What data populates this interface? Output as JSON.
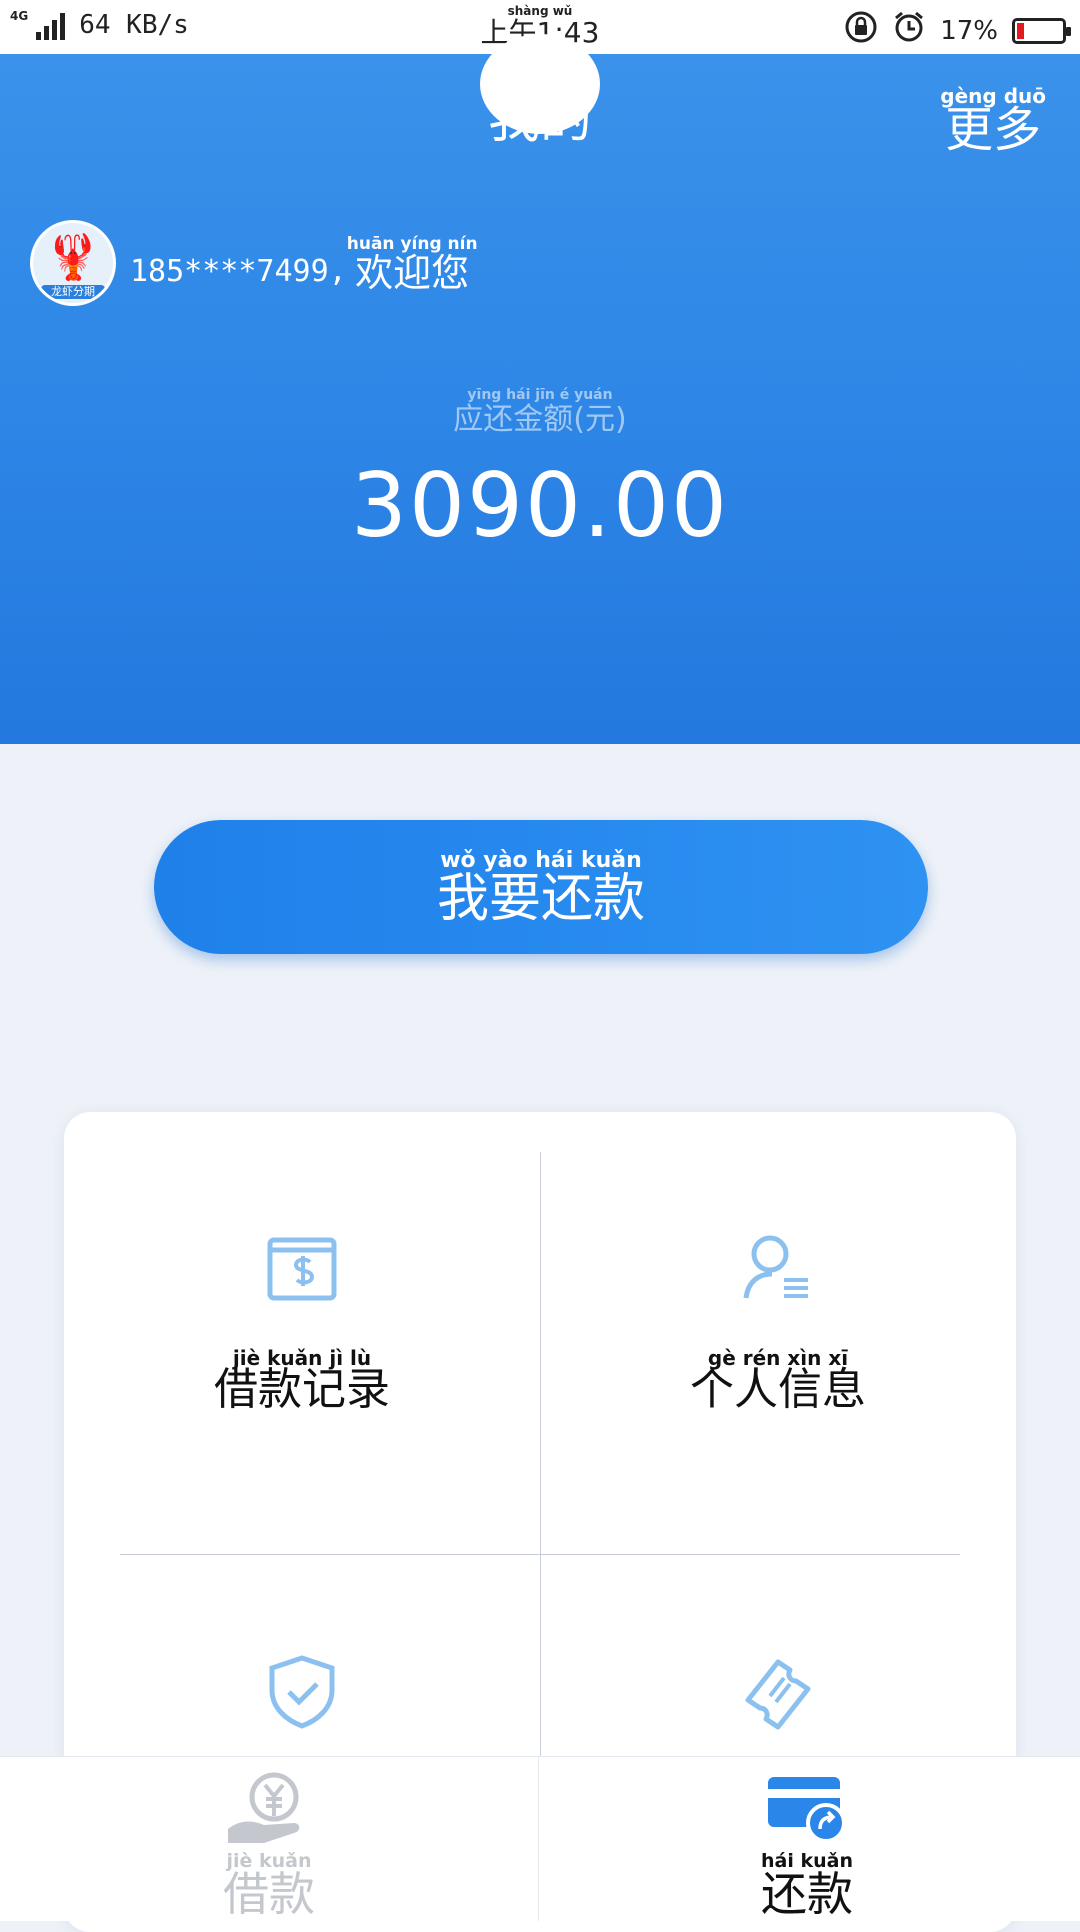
{
  "status_bar": {
    "network": "4G",
    "speed": "64 KB/s",
    "time_ruby": "shàng wǔ",
    "time": "上午1:43",
    "battery_text": "17%",
    "battery_level": 0.17,
    "battery_color": "#e21b23"
  },
  "header": {
    "title": "我的",
    "more_pinyin": "gèng duō",
    "more": "更多",
    "background_color": "#2d85e6"
  },
  "user": {
    "avatar_label": "龙虾分期",
    "phone": "185****7499,",
    "welcome_pinyin": "huān yíng nín",
    "welcome": "欢迎您"
  },
  "repayment": {
    "label_pinyin": "yīng hái jīn é yuán",
    "label": "应还金额(元)",
    "amount": "3090.00"
  },
  "repay_button": {
    "pinyin": "wǒ yào hái kuǎn",
    "label": "我要还款",
    "color": "#1f80ea"
  },
  "grid": {
    "items": [
      {
        "pinyin": "jiè kuǎn jì lù",
        "label": "借款记录",
        "icon": "wallet-dollar-icon"
      },
      {
        "pinyin": "gè rén xìn xī",
        "label": "个人信息",
        "icon": "user-info-icon"
      },
      {
        "pinyin": "",
        "label": "",
        "icon": "shield-check-icon"
      },
      {
        "pinyin": "",
        "label": "",
        "icon": "coupon-ticket-icon"
      }
    ],
    "icon_color": "#8cc1ef"
  },
  "bottom_nav": {
    "tabs": [
      {
        "pinyin": "jiè kuǎn",
        "label": "借款",
        "icon": "yen-hand-icon",
        "active": false
      },
      {
        "pinyin": "hái kuǎn",
        "label": "还款",
        "icon": "card-repay-icon",
        "active": true
      }
    ],
    "active_color": "#2a86e8",
    "inactive_color": "#c4c8ce"
  }
}
